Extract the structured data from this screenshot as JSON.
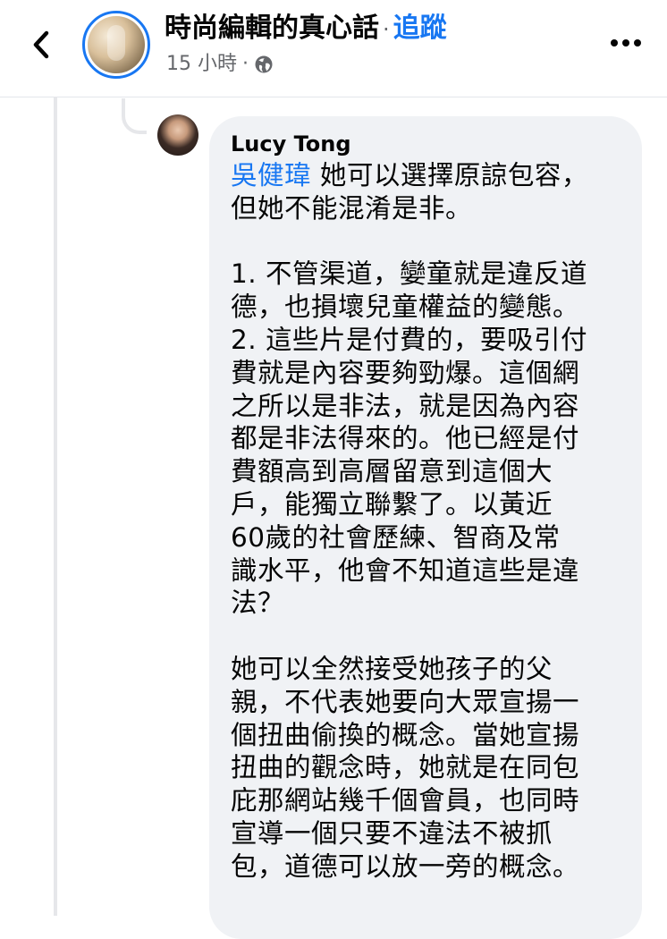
{
  "header": {
    "back_icon": "chevron-left-icon",
    "page_name": "時尚編輯的真心話",
    "separator": "·",
    "follow_label": "追蹤",
    "time_ago": "15 小時",
    "meta_separator": "·",
    "privacy_icon": "globe-icon",
    "more_icon": "more-horizontal-icon"
  },
  "comment": {
    "author": "Lucy Tong",
    "mention": "吳健瑋",
    "lines": [
      " 她可以選擇原諒包容，",
      "但她不能混淆是非。",
      "",
      "1. 不管渠道，孌童就是違反道",
      "德，也損壞兒童權益的變態。",
      "2. 這些片是付費的，要吸引付",
      "費就是內容要夠勁爆。這個網",
      "之所以是非法，就是因為內容",
      "都是非法得來的。他已經是付",
      "費額高到高層留意到這個大",
      "戶，能獨立聯繫了。以黃近",
      "60歲的社會歷練、智商及常",
      "識水平，他會不知道這些是違",
      "法？",
      "",
      "她可以全然接受她孩子的父",
      "親，不代表她要向大眾宣揚一",
      "個扭曲偷換的概念。當她宣揚",
      "扭曲的觀念時，她就是在同包",
      "庇那網站幾千個會員，也同時",
      "宣導一個只要不違法不被抓",
      "包，道德可以放一旁的概念。"
    ]
  },
  "colors": {
    "accent": "#1877f2",
    "bubble_bg": "#f0f2f5",
    "secondary_text": "#65676b"
  }
}
